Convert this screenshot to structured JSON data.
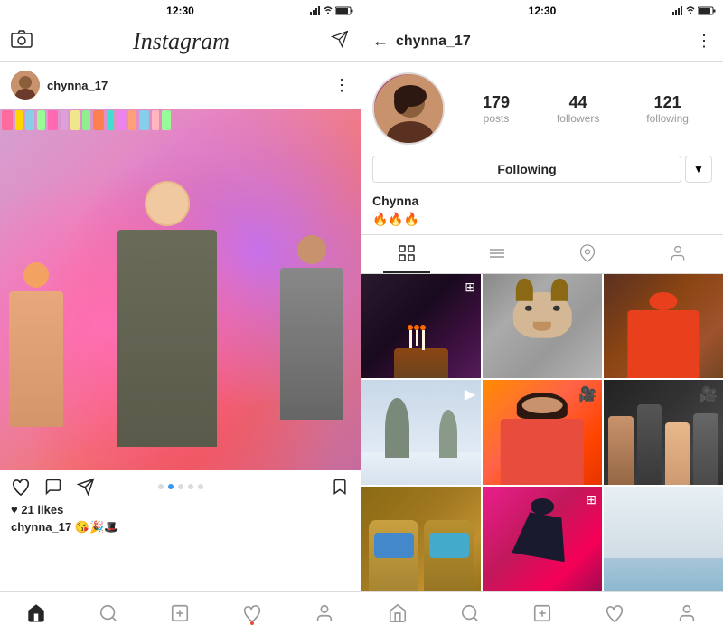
{
  "left": {
    "status_time": "12:30",
    "header_logo": "Instagram",
    "post": {
      "username": "chynna_17",
      "likes": "♥ 21 likes",
      "caption_user": "chynna_17",
      "caption_text": "😘🎉🎩"
    },
    "nav": {
      "home": "⌂",
      "search": "🔍",
      "add": "+",
      "heart": "♥",
      "profile": "👤"
    }
  },
  "right": {
    "status_time": "12:30",
    "header_username": "chynna_17",
    "profile": {
      "name": "Chynna",
      "bio": "🔥🔥🔥",
      "posts_count": "179",
      "posts_label": "posts",
      "followers_count": "44",
      "followers_label": "followers",
      "following_count": "121",
      "following_label": "following",
      "following_btn": "Following"
    },
    "tabs": {
      "grid": "⊞",
      "list": "≡",
      "location": "📍",
      "tag": "👤"
    },
    "nav": {
      "home": "⌂",
      "search": "🔍",
      "add": "+",
      "heart": "♥",
      "profile": "👤"
    }
  }
}
